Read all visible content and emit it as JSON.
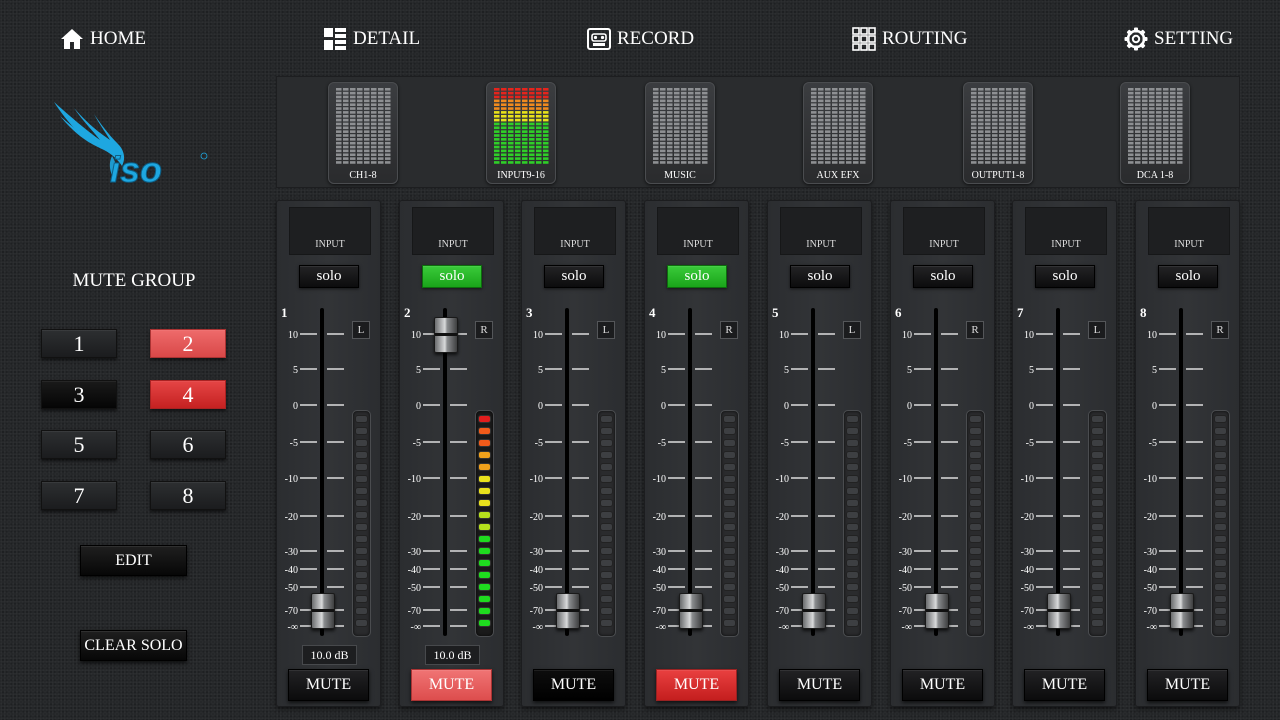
{
  "nav": [
    {
      "label": "HOME",
      "icon": "home-icon"
    },
    {
      "label": "DETAIL",
      "icon": "detail-icon"
    },
    {
      "label": "RECORD",
      "icon": "record-icon"
    },
    {
      "label": "ROUTING",
      "icon": "routing-icon"
    },
    {
      "label": "SETTING",
      "icon": "gear-icon"
    }
  ],
  "logo": {
    "text": "iso"
  },
  "mute_group": {
    "title": "MUTE GROUP",
    "buttons": [
      {
        "label": "1",
        "active": false
      },
      {
        "label": "2",
        "active": true
      },
      {
        "label": "3",
        "active": false
      },
      {
        "label": "4",
        "active": true
      },
      {
        "label": "5",
        "active": false
      },
      {
        "label": "6",
        "active": false
      },
      {
        "label": "7",
        "active": false
      },
      {
        "label": "8",
        "active": false
      }
    ],
    "edit_label": "EDIT",
    "clear_solo_label": "CLEAR SOLO"
  },
  "banks": [
    {
      "label": "CH1-8",
      "active": false
    },
    {
      "label": "INPUT9-16",
      "active": true
    },
    {
      "label": "MUSIC",
      "active": false
    },
    {
      "label": "AUX EFX",
      "active": false
    },
    {
      "label": "OUTPUT1-8",
      "active": false
    },
    {
      "label": "DCA 1-8",
      "active": false
    }
  ],
  "scale_labels": [
    "10",
    "5",
    "0",
    "-5",
    "-10",
    "-20",
    "-30",
    "-40",
    "-50",
    "-70",
    "-∞"
  ],
  "channels": [
    {
      "num": "1",
      "display": "INPUT",
      "solo_label": "solo",
      "solo_on": false,
      "side": "L",
      "fader_db": "10.0 dB",
      "mute_label": "MUTE",
      "mute_on": false,
      "meter_level": 0,
      "fader_pos": "-70"
    },
    {
      "num": "2",
      "display": "INPUT",
      "solo_label": "solo",
      "solo_on": true,
      "side": "R",
      "fader_db": "10.0 dB",
      "mute_label": "MUTE",
      "mute_on": true,
      "meter_level": 1,
      "fader_pos": "10"
    },
    {
      "num": "3",
      "display": "INPUT",
      "solo_label": "solo",
      "solo_on": false,
      "side": "L",
      "fader_db": "",
      "mute_label": "MUTE",
      "mute_on": false,
      "meter_level": 0,
      "fader_pos": "-70"
    },
    {
      "num": "4",
      "display": "INPUT",
      "solo_label": "solo",
      "solo_on": true,
      "side": "R",
      "fader_db": "",
      "mute_label": "MUTE",
      "mute_on": true,
      "meter_level": 0,
      "fader_pos": "-70"
    },
    {
      "num": "5",
      "display": "INPUT",
      "solo_label": "solo",
      "solo_on": false,
      "side": "L",
      "fader_db": "",
      "mute_label": "MUTE",
      "mute_on": false,
      "meter_level": 0,
      "fader_pos": "-70"
    },
    {
      "num": "6",
      "display": "INPUT",
      "solo_label": "solo",
      "solo_on": false,
      "side": "R",
      "fader_db": "",
      "mute_label": "MUTE",
      "mute_on": false,
      "meter_level": 0,
      "fader_pos": "-70"
    },
    {
      "num": "7",
      "display": "INPUT",
      "solo_label": "solo",
      "solo_on": false,
      "side": "L",
      "fader_db": "",
      "mute_label": "MUTE",
      "mute_on": false,
      "meter_level": 0,
      "fader_pos": "-70"
    },
    {
      "num": "8",
      "display": "INPUT",
      "solo_label": "solo",
      "solo_on": false,
      "side": "R",
      "fader_db": "",
      "mute_label": "MUTE",
      "mute_on": false,
      "meter_level": 0,
      "fader_pos": "-70"
    }
  ],
  "colors": {
    "mute_active": "#d94848",
    "solo_active": "#22aa22",
    "logo_blue": "#1ea7e0"
  }
}
